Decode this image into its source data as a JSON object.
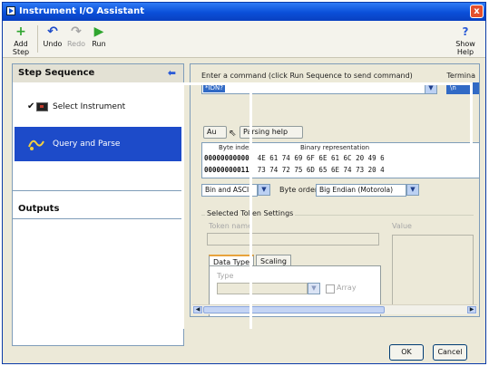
{
  "window": {
    "title": "Instrument I/O Assistant",
    "close_glyph": "x"
  },
  "toolbar": {
    "add_step": "Add Step",
    "undo": "Undo",
    "redo": "Redo",
    "run": "Run",
    "show_help": "Show Help"
  },
  "step_sequence": {
    "header": "Step Sequence",
    "steps": [
      {
        "label": "Select Instrument"
      },
      {
        "label": "Query and Parse"
      }
    ]
  },
  "outputs": {
    "header": "Outputs"
  },
  "command": {
    "label": "Enter a command (click Run Sequence to send command)",
    "value": "*IDN?",
    "terminator_label": "Termina",
    "terminator_value": "\\n"
  },
  "tabs": {
    "auto_parse": "Au",
    "parsing_help": "Parsing help"
  },
  "binary": {
    "col_byte_index": "Byte index",
    "col_binary": "Binary representation",
    "rows": [
      {
        "index": "00000000000:",
        "bytes": "4E 61 74 69 6F 6E 61 6C 20 49 6"
      },
      {
        "index": "00000000011:",
        "bytes": "73 74 72 75 6D 65 6E 74 73 20 4"
      }
    ]
  },
  "format": {
    "display_mode": "Bin and ASCII",
    "byte_order_label": "Byte order",
    "byte_order": "Big Endian (Motorola)"
  },
  "token_settings": {
    "group_title": "Selected Token Settings",
    "token_name_label": "Token name",
    "value_label": "Value",
    "tab_data_type": "Data Type",
    "tab_scaling": "Scaling",
    "type_label": "Type",
    "array_label": "Array"
  },
  "buttons": {
    "ok": "OK",
    "cancel": "Cancel"
  },
  "colors": {
    "title_bar": "#0a4fd8",
    "selection": "#1d4bc9"
  }
}
